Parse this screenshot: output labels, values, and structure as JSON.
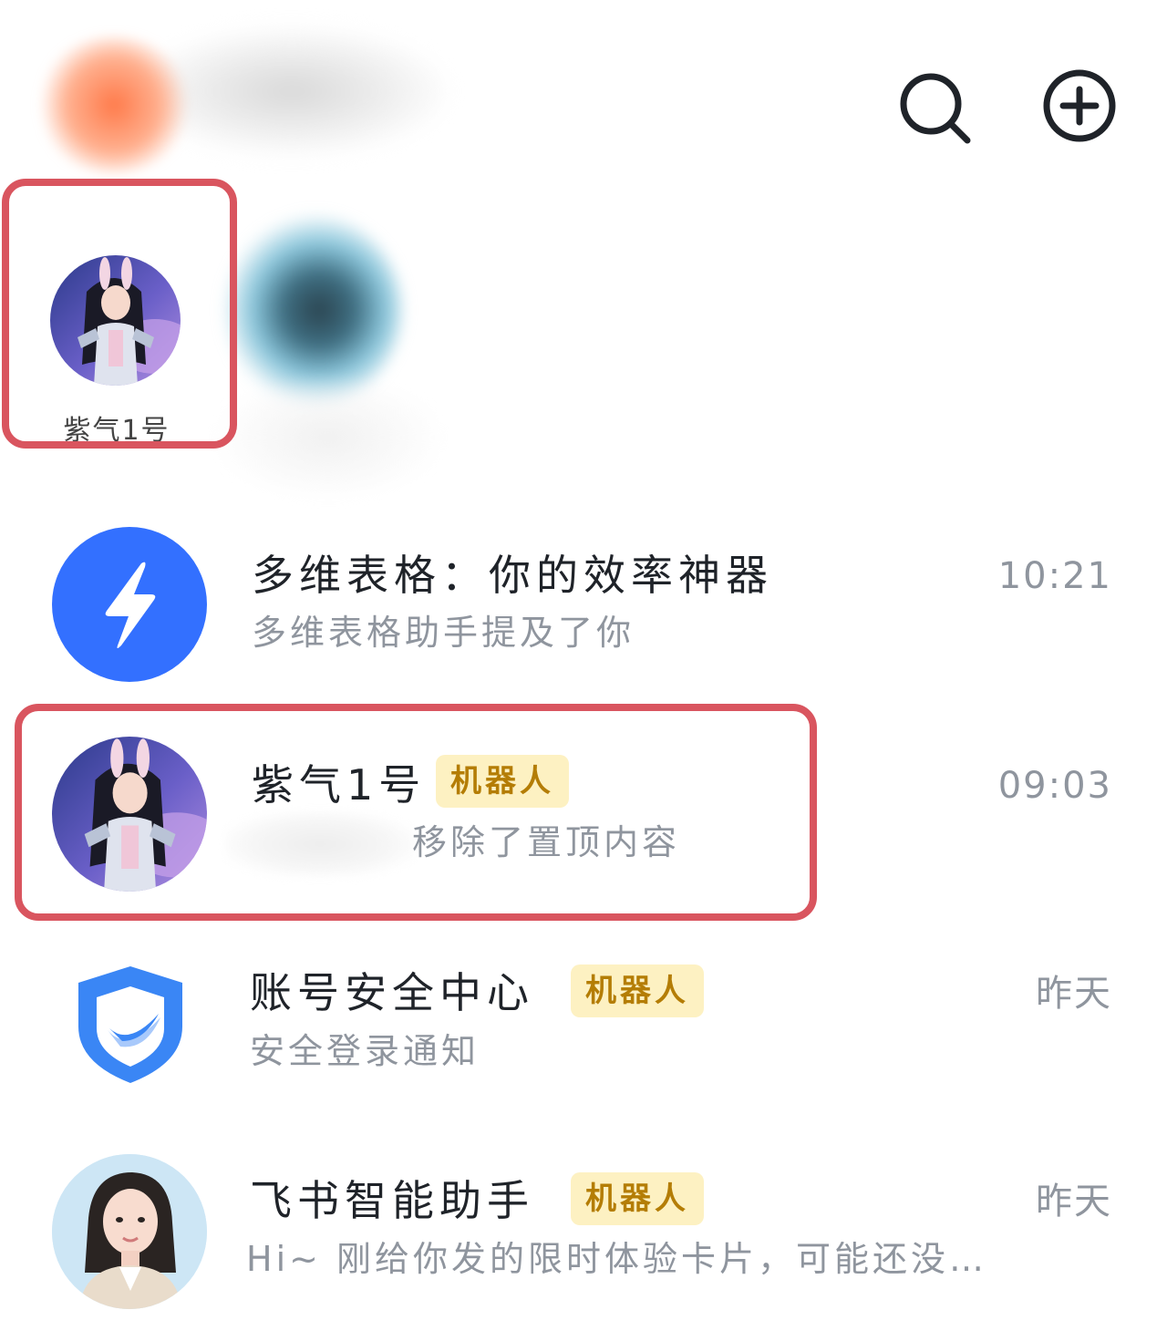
{
  "header": {
    "search_icon": "search-icon",
    "add_icon": "plus-circle-icon"
  },
  "pinned": [
    {
      "name": "紫气1号",
      "avatar": "robot-girl-avatar"
    }
  ],
  "chats": [
    {
      "name": "多维表格：你的效率神器",
      "preview": "多维表格助手提及了你",
      "time": "10:21",
      "badge": "",
      "avatar": "lightning-icon"
    },
    {
      "name": "紫气1号",
      "preview": "移除了置顶内容",
      "time": "09:03",
      "badge": "机器人",
      "avatar": "robot-girl-avatar"
    },
    {
      "name": "账号安全中心",
      "preview": "安全登录通知",
      "time": "昨天",
      "badge": "机器人",
      "avatar": "shield-icon"
    },
    {
      "name": "飞书智能助手",
      "preview": "Hi~ 刚给你发的限时体验卡片，可能还没…",
      "time": "昨天",
      "badge": "机器人",
      "avatar": "assistant-woman-avatar"
    }
  ],
  "colors": {
    "highlight": "#d9555f",
    "accent_blue": "#3370ff",
    "badge_bg": "#fdf1c2",
    "badge_text": "#b47d05"
  }
}
